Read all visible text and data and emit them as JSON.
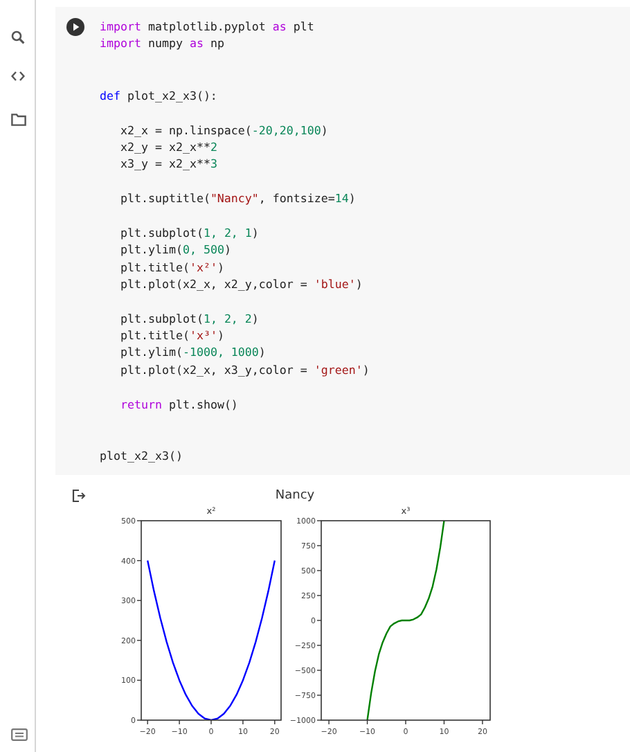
{
  "code_cell": {
    "lines": [
      {
        "kind": "code",
        "tokens": [
          {
            "text": "import",
            "kind": "keyword"
          },
          {
            "text": " matplotlib.pyplot ",
            "kind": "plain"
          },
          {
            "text": "as",
            "kind": "keyword"
          },
          {
            "text": " plt",
            "kind": "plain"
          }
        ]
      },
      {
        "kind": "code",
        "tokens": [
          {
            "text": "import",
            "kind": "keyword"
          },
          {
            "text": " numpy ",
            "kind": "plain"
          },
          {
            "text": "as",
            "kind": "keyword"
          },
          {
            "text": " np",
            "kind": "plain"
          }
        ]
      },
      {
        "kind": "blank"
      },
      {
        "kind": "blank"
      },
      {
        "kind": "code",
        "tokens": [
          {
            "text": "def",
            "kind": "def"
          },
          {
            "text": " plot_x2_x3():",
            "kind": "plain"
          }
        ],
        "children": [
          {
            "kind": "blank"
          },
          {
            "kind": "code",
            "tokens": [
              {
                "text": "x2_x = np.linspace(",
                "kind": "plain"
              },
              {
                "text": "-20,20,100",
                "kind": "number"
              },
              {
                "text": ")",
                "kind": "plain"
              }
            ]
          },
          {
            "kind": "code",
            "tokens": [
              {
                "text": "x2_y = x2_x**",
                "kind": "plain"
              },
              {
                "text": "2",
                "kind": "number"
              }
            ]
          },
          {
            "kind": "code",
            "tokens": [
              {
                "text": "x3_y = x2_x**",
                "kind": "plain"
              },
              {
                "text": "3",
                "kind": "number"
              }
            ]
          },
          {
            "kind": "blank"
          },
          {
            "kind": "code",
            "tokens": [
              {
                "text": "plt.suptitle(",
                "kind": "plain"
              },
              {
                "text": "\"Nancy\"",
                "kind": "string"
              },
              {
                "text": ", fontsize=",
                "kind": "plain"
              },
              {
                "text": "14",
                "kind": "number"
              },
              {
                "text": ")",
                "kind": "plain"
              }
            ]
          },
          {
            "kind": "blank"
          },
          {
            "kind": "code",
            "tokens": [
              {
                "text": "plt.subplot(",
                "kind": "plain"
              },
              {
                "text": "1, 2, 1",
                "kind": "number"
              },
              {
                "text": ")",
                "kind": "plain"
              }
            ]
          },
          {
            "kind": "code",
            "tokens": [
              {
                "text": "plt.ylim(",
                "kind": "plain"
              },
              {
                "text": "0, 500",
                "kind": "number"
              },
              {
                "text": ")",
                "kind": "plain"
              }
            ]
          },
          {
            "kind": "code",
            "tokens": [
              {
                "text": "plt.title(",
                "kind": "plain"
              },
              {
                "text": "'x²'",
                "kind": "string"
              },
              {
                "text": ")",
                "kind": "plain"
              }
            ]
          },
          {
            "kind": "code",
            "tokens": [
              {
                "text": "plt.plot(x2_x, x2_y,color = ",
                "kind": "plain"
              },
              {
                "text": "'blue'",
                "kind": "string"
              },
              {
                "text": ")",
                "kind": "plain"
              }
            ]
          },
          {
            "kind": "blank"
          },
          {
            "kind": "code",
            "tokens": [
              {
                "text": "plt.subplot(",
                "kind": "plain"
              },
              {
                "text": "1, 2, 2",
                "kind": "number"
              },
              {
                "text": ")",
                "kind": "plain"
              }
            ]
          },
          {
            "kind": "code",
            "tokens": [
              {
                "text": "plt.title(",
                "kind": "plain"
              },
              {
                "text": "'x³'",
                "kind": "string"
              },
              {
                "text": ")",
                "kind": "plain"
              }
            ]
          },
          {
            "kind": "code",
            "tokens": [
              {
                "text": "plt.ylim(",
                "kind": "plain"
              },
              {
                "text": "-1000, 1000",
                "kind": "number"
              },
              {
                "text": ")",
                "kind": "plain"
              }
            ]
          },
          {
            "kind": "code",
            "tokens": [
              {
                "text": "plt.plot(x2_x, x3_y,color = ",
                "kind": "plain"
              },
              {
                "text": "'green'",
                "kind": "string"
              },
              {
                "text": ")",
                "kind": "plain"
              }
            ]
          },
          {
            "kind": "blank"
          },
          {
            "kind": "code",
            "tokens": [
              {
                "text": "return",
                "kind": "keyword"
              },
              {
                "text": " plt.show()",
                "kind": "plain"
              }
            ]
          }
        ]
      },
      {
        "kind": "blank"
      },
      {
        "kind": "blank"
      },
      {
        "kind": "code",
        "tokens": [
          {
            "text": "plot_x2_x3()",
            "kind": "plain"
          }
        ]
      }
    ]
  },
  "output": {
    "suptitle": "Nancy",
    "subplots": [
      {
        "chart_data": {
          "type": "line",
          "title": "x²",
          "x": [
            -20,
            -18,
            -16,
            -14,
            -12,
            -10,
            -8,
            -6,
            -4,
            -2,
            0,
            2,
            4,
            6,
            8,
            10,
            12,
            14,
            16,
            18,
            20
          ],
          "series": [
            {
              "color": "#0000ff",
              "values": [
                400,
                324,
                256,
                196,
                144,
                100,
                64,
                36,
                16,
                4,
                0,
                4,
                16,
                36,
                64,
                100,
                144,
                196,
                256,
                324,
                400
              ]
            }
          ],
          "xlim": [
            -22,
            22
          ],
          "ylim": [
            0,
            500
          ],
          "xticks": [
            {
              "value": -20,
              "label": "−20"
            },
            {
              "value": -10,
              "label": "−10"
            },
            {
              "value": 0,
              "label": "0"
            },
            {
              "value": 10,
              "label": "10"
            },
            {
              "value": 20,
              "label": "20"
            }
          ],
          "yticks": [
            {
              "value": 0,
              "label": "0"
            },
            {
              "value": 100,
              "label": "100"
            },
            {
              "value": 200,
              "label": "200"
            },
            {
              "value": 300,
              "label": "300"
            },
            {
              "value": 400,
              "label": "400"
            },
            {
              "value": 500,
              "label": "500"
            }
          ]
        }
      },
      {
        "chart_data": {
          "type": "line",
          "title": "x³",
          "x": [
            -10,
            -9,
            -8,
            -7,
            -6,
            -5,
            -4,
            -3,
            -2,
            -1,
            0,
            1,
            2,
            3,
            4,
            5,
            6,
            7,
            8,
            9,
            10
          ],
          "series": [
            {
              "color": "#008000",
              "values": [
                -1000,
                -730,
                -510,
                -340,
                -220,
                -130,
                -60,
                -30,
                -10,
                0,
                0,
                0,
                10,
                30,
                60,
                130,
                220,
                340,
                510,
                730,
                1000
              ]
            }
          ],
          "xlim": [
            -22,
            22
          ],
          "ylim": [
            -1000,
            1000
          ],
          "xticks": [
            {
              "value": -20,
              "label": "−20"
            },
            {
              "value": -10,
              "label": "−10"
            },
            {
              "value": 0,
              "label": "0"
            },
            {
              "value": 10,
              "label": "10"
            },
            {
              "value": 20,
              "label": "20"
            }
          ],
          "yticks": [
            {
              "value": -1000,
              "label": "−1000"
            },
            {
              "value": -750,
              "label": "−750"
            },
            {
              "value": -500,
              "label": "−500"
            },
            {
              "value": -250,
              "label": "−250"
            },
            {
              "value": 0,
              "label": "0"
            },
            {
              "value": 250,
              "label": "250"
            },
            {
              "value": 500,
              "label": "500"
            },
            {
              "value": 750,
              "label": "750"
            },
            {
              "value": 1000,
              "label": "1000"
            }
          ]
        }
      }
    ]
  }
}
